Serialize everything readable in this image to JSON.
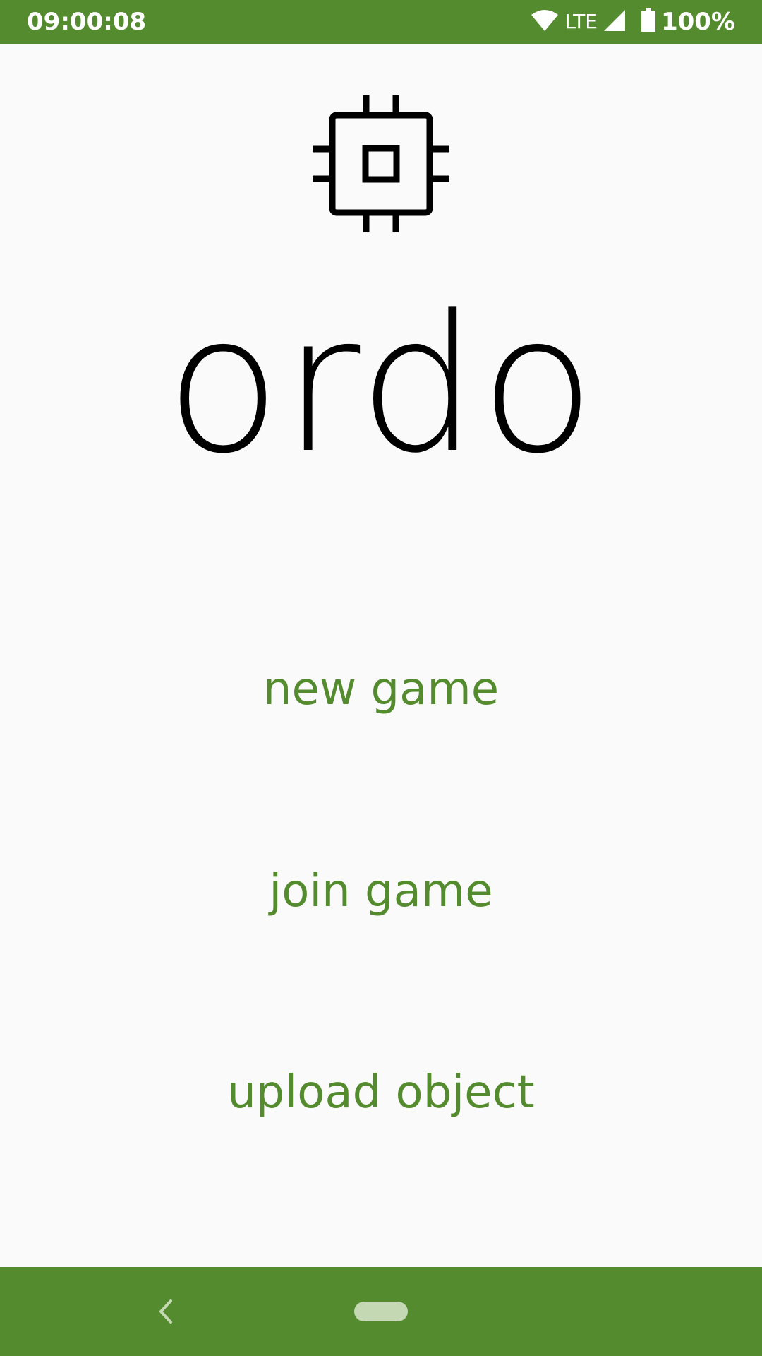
{
  "status_bar": {
    "time": "09:00:08",
    "network": "LTE",
    "battery": "100%",
    "icons": [
      "wifi-icon",
      "signal-icon",
      "battery-icon"
    ]
  },
  "logo": {
    "icon": "chip-icon",
    "title": "ordo"
  },
  "menu": {
    "new_game": "new game",
    "join_game": "join game",
    "upload_object": "upload object"
  },
  "nav_bar": {
    "icons": [
      "back-icon",
      "home-pill-icon"
    ]
  },
  "colors": {
    "accent": "#558b2f",
    "background": "#fafafa",
    "title": "#000000"
  }
}
